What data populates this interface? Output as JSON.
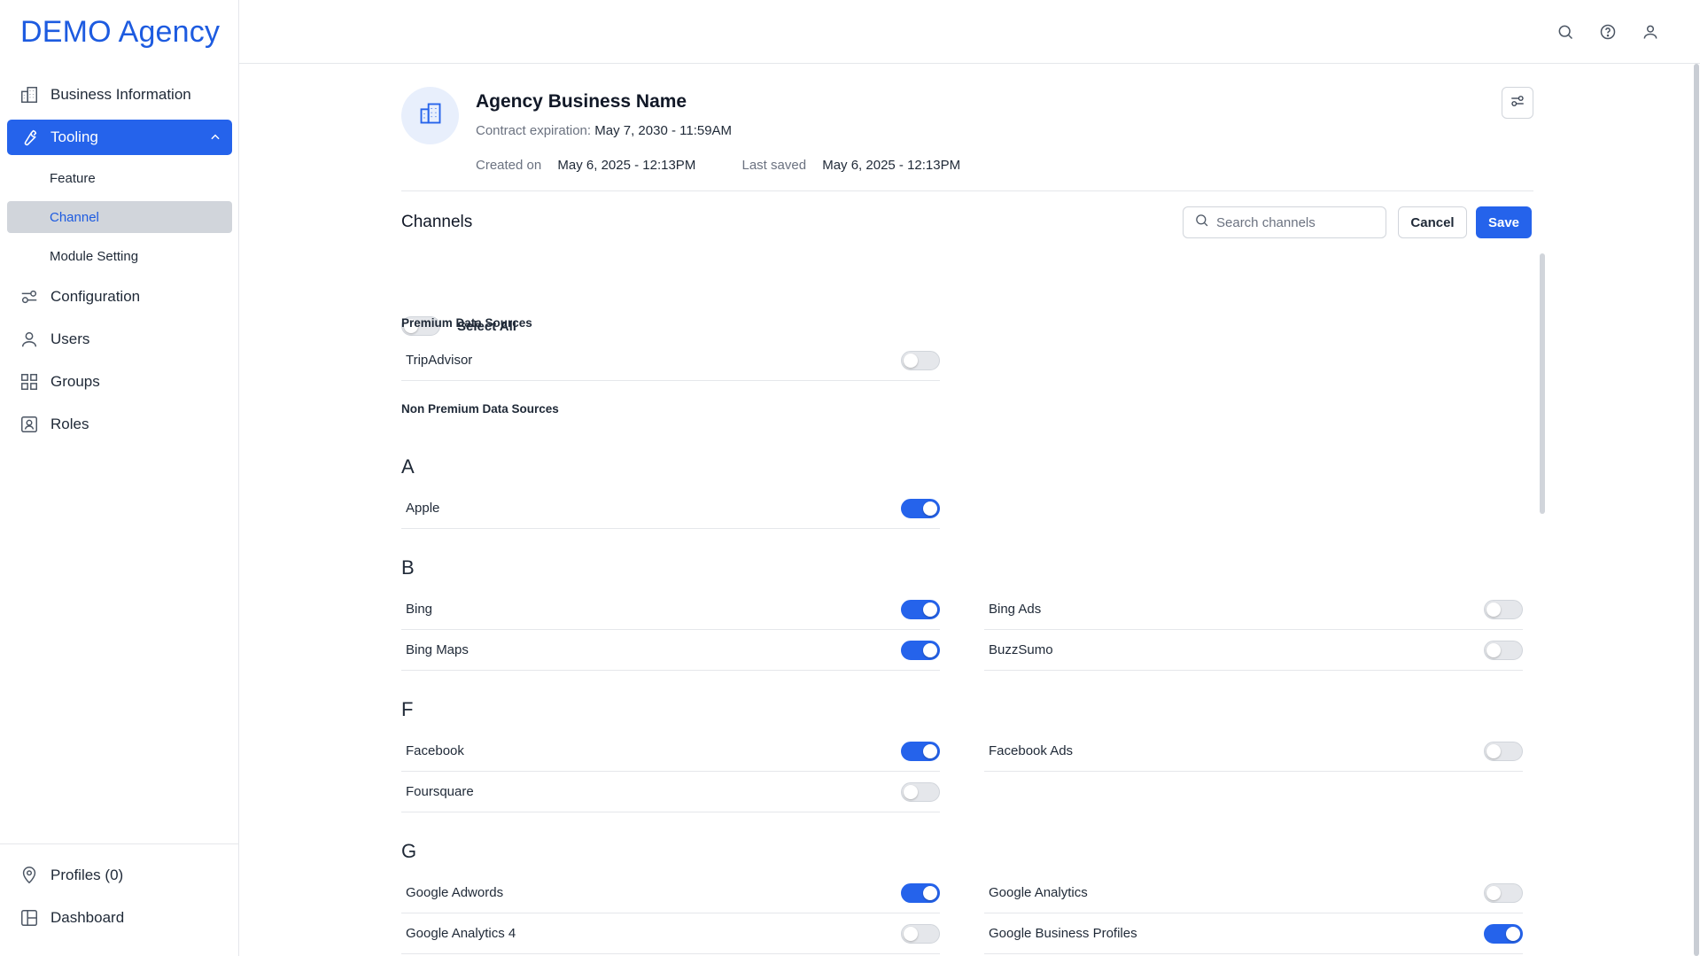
{
  "brand": "DEMO Agency",
  "sidebar": {
    "items": [
      {
        "label": "Business Information",
        "icon": "building-icon"
      },
      {
        "label": "Tooling",
        "icon": "wrench-icon"
      },
      {
        "label": "Configuration",
        "icon": "sliders-icon"
      },
      {
        "label": "Users",
        "icon": "user-icon"
      },
      {
        "label": "Groups",
        "icon": "grid-icon"
      },
      {
        "label": "Roles",
        "icon": "id-card-icon"
      }
    ],
    "sub_items": [
      "Feature",
      "Channel",
      "Module Setting"
    ],
    "bottom_items": [
      {
        "label": "Profiles (0)",
        "icon": "location-pin-icon"
      },
      {
        "label": "Dashboard",
        "icon": "dashboard-icon"
      }
    ]
  },
  "topbar": {
    "icons": [
      "search-icon",
      "help-icon",
      "user-icon"
    ]
  },
  "business": {
    "name": "Agency Business Name",
    "contract_label": "Contract expiration:",
    "contract_value": "May 7, 2030 - 11:59AM",
    "created_label": "Created on",
    "created_value": "May 6, 2025 - 12:13PM",
    "saved_label": "Last saved",
    "saved_value": "May 6, 2025 - 12:13PM"
  },
  "channels": {
    "title": "Channels",
    "search_placeholder": "Search channels",
    "cancel_label": "Cancel",
    "save_label": "Save",
    "select_all_label": "Select All",
    "select_all_on": false,
    "premium_title": "Premium Data Sources",
    "premium": [
      {
        "name": "TripAdvisor",
        "on": false
      }
    ],
    "non_premium_title": "Non Premium Data Sources",
    "groups": [
      {
        "letter": "A",
        "items": [
          {
            "name": "Apple",
            "on": true
          }
        ]
      },
      {
        "letter": "B",
        "items": [
          {
            "name": "Bing",
            "on": true
          },
          {
            "name": "Bing Ads",
            "on": false
          },
          {
            "name": "Bing Maps",
            "on": true
          },
          {
            "name": "BuzzSumo",
            "on": false
          }
        ]
      },
      {
        "letter": "F",
        "items": [
          {
            "name": "Facebook",
            "on": true
          },
          {
            "name": "Facebook Ads",
            "on": false
          },
          {
            "name": "Foursquare",
            "on": false
          }
        ]
      },
      {
        "letter": "G",
        "items": [
          {
            "name": "Google Adwords",
            "on": true
          },
          {
            "name": "Google Analytics",
            "on": false
          },
          {
            "name": "Google Analytics 4",
            "on": false
          },
          {
            "name": "Google Business Profiles",
            "on": true
          }
        ]
      }
    ]
  },
  "colors": {
    "accent": "#2563eb",
    "brand": "#1d5be0",
    "active_sub_bg": "#d1d5db"
  }
}
